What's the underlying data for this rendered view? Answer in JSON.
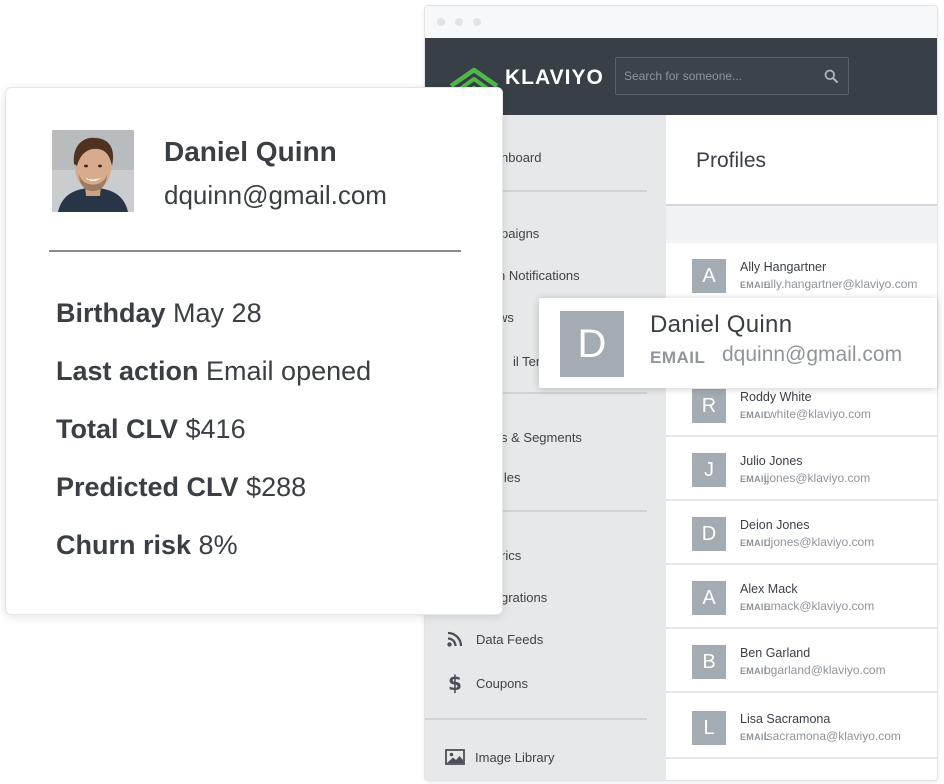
{
  "app": {
    "brand": "KLAVIYO",
    "search": {
      "placeholder": "Search for someone..."
    },
    "sidebar": {
      "items": [
        {
          "label": "hboard",
          "icon": "dashboard-icon"
        },
        {
          "label": "paigns",
          "icon": "campaigns-icon"
        },
        {
          "label": "n Notifications",
          "icon": "flow-notifications-icon"
        },
        {
          "label": "ws",
          "icon": "flows-icon"
        },
        {
          "label": "il Tem",
          "icon": "email-templates-icon"
        },
        {
          "label": "s & Segments",
          "icon": "lists-segments-icon"
        },
        {
          "label": "iles",
          "icon": "profiles-icon"
        },
        {
          "label": "rics",
          "icon": "metrics-icon"
        },
        {
          "label": "grations",
          "icon": "integrations-icon"
        },
        {
          "label": "Data Feeds",
          "icon": "rss-icon"
        },
        {
          "label": "Coupons",
          "icon": "dollar-icon"
        },
        {
          "label": "Image Library",
          "icon": "image-icon"
        }
      ]
    },
    "main": {
      "title": "Profiles",
      "email_tag": "EMAIL",
      "profiles": [
        {
          "initial": "A",
          "name": "Ally Hangartner",
          "email": "ally.hangartner@klaviyo.com"
        },
        {
          "initial": "R",
          "name": "Roddy White",
          "email": "rwhite@klaviyo.com"
        },
        {
          "initial": "J",
          "name": "Julio Jones",
          "email": "jjones@klaviyo.com"
        },
        {
          "initial": "D",
          "name": "Deion Jones",
          "email": "djones@klaviyo.com"
        },
        {
          "initial": "A",
          "name": "Alex Mack",
          "email": "amack@klaviyo.com"
        },
        {
          "initial": "B",
          "name": "Ben Garland",
          "email": "bgarland@klaviyo.com"
        },
        {
          "initial": "L",
          "name": "Lisa Sacramona",
          "email": "lsacramona@klaviyo.com"
        }
      ]
    },
    "highlighted_profile": {
      "initial": "D",
      "name": "Daniel Quinn",
      "email_tag": "EMAIL",
      "email": "dquinn@gmail.com"
    }
  },
  "detail_card": {
    "name": "Daniel Quinn",
    "email": "dquinn@gmail.com",
    "stats": [
      {
        "label": "Birthday",
        "value": "May 28"
      },
      {
        "label": "Last action",
        "value": "Email opened"
      },
      {
        "label": "Total CLV",
        "value": "$416"
      },
      {
        "label": "Predicted CLV",
        "value": "$288"
      },
      {
        "label": "Churn risk",
        "value": "8%"
      }
    ]
  },
  "colors": {
    "topbar": "#383f47",
    "sidebar": "#e6e8ea",
    "logo_green": "#4fb848",
    "avatar_gray": "#a3abb3",
    "text_dark": "#3a3f45",
    "text_muted": "#8f959b"
  }
}
